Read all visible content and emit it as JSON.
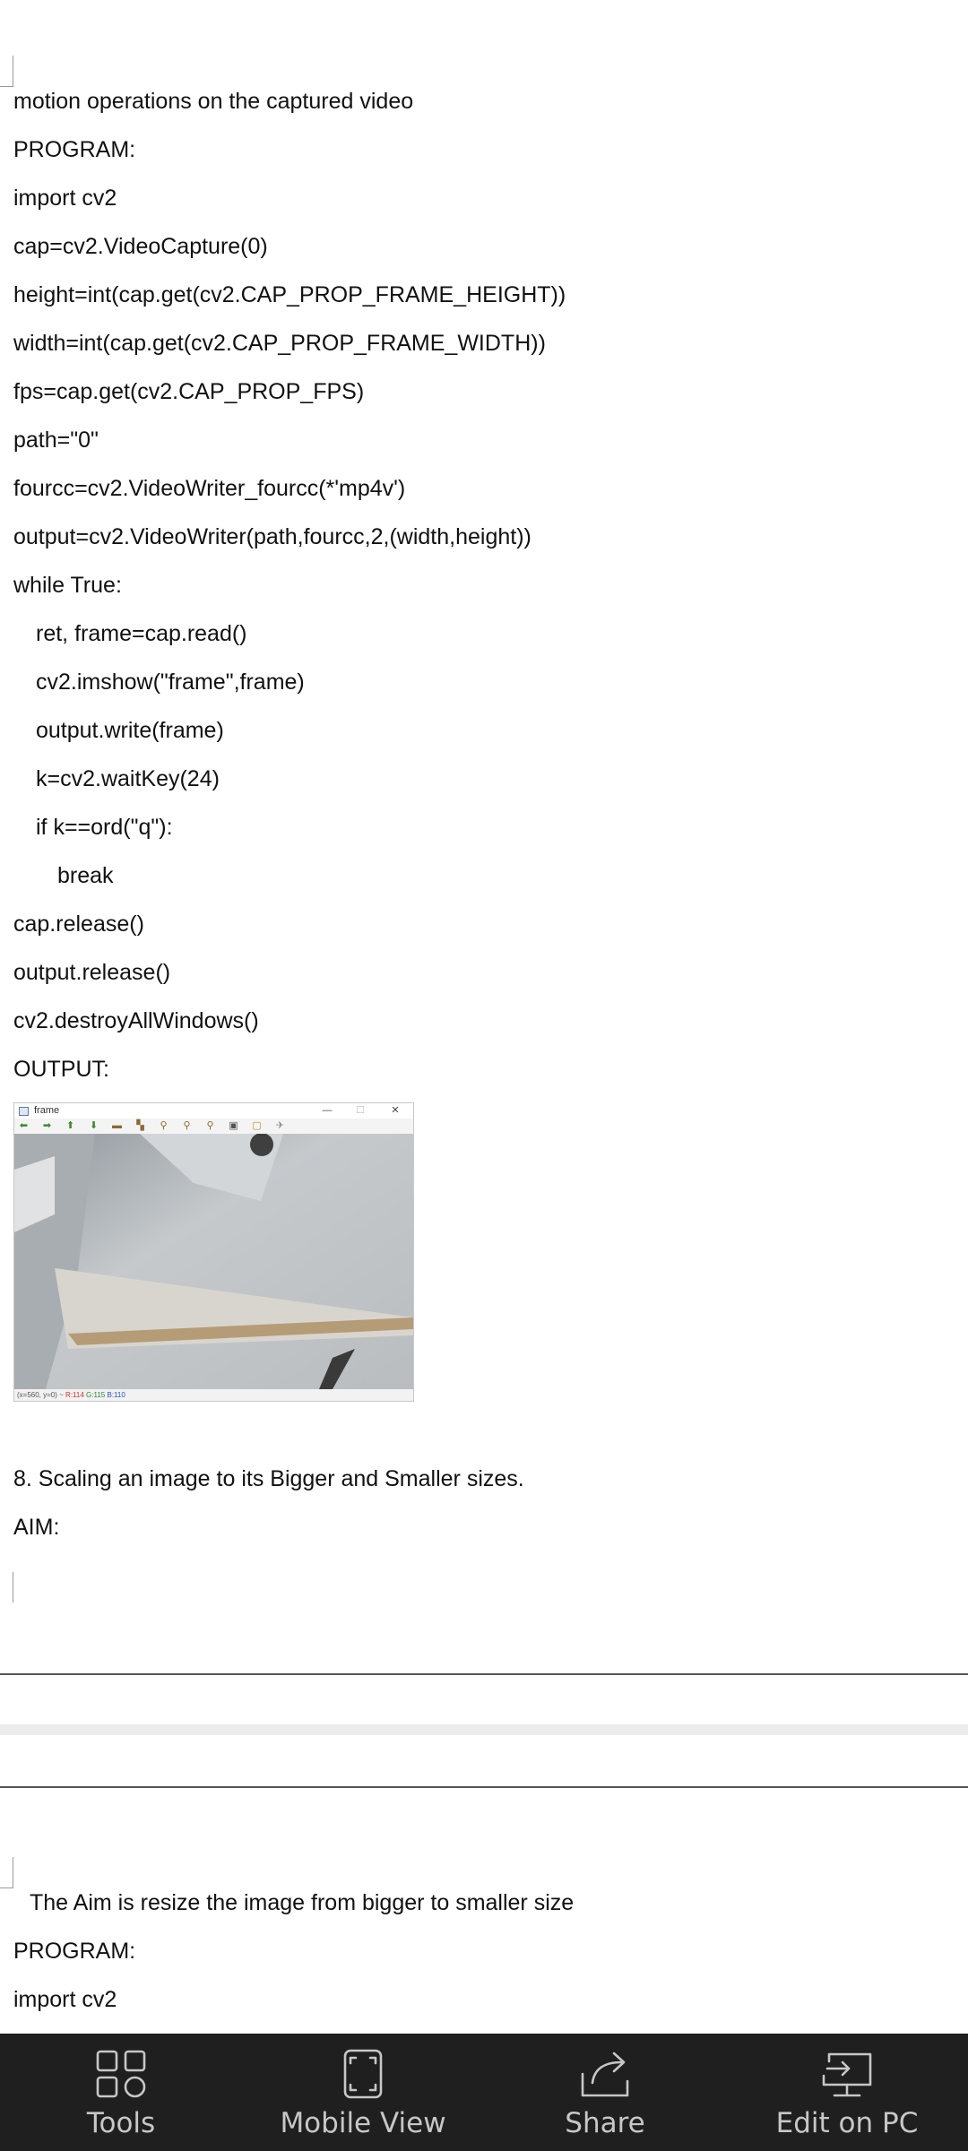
{
  "document": {
    "page1_lines": [
      "motion operations on the captured video",
      "PROGRAM:",
      "import cv2",
      "cap=cv2.VideoCapture(0)",
      "height=int(cap.get(cv2.CAP_PROP_FRAME_HEIGHT))",
      "width=int(cap.get(cv2.CAP_PROP_FRAME_WIDTH))",
      "fps=cap.get(cv2.CAP_PROP_FPS)",
      "path=\"0\"",
      "fourcc=cv2.VideoWriter_fourcc(*'mp4v')",
      "output=cv2.VideoWriter(path,fourcc,2,(width,height))",
      "while True:",
      "ret, frame=cap.read()",
      "cv2.imshow(\"frame\",frame)",
      "output.write(frame)",
      "k=cv2.waitKey(24)",
      "if k==ord(\"q\"):",
      "break",
      "cap.release()",
      "output.release()",
      "cv2.destroyAllWindows()",
      "OUTPUT:"
    ],
    "section_heading": "8. Scaling an image to its Bigger and Smaller sizes.",
    "aim_label": "AIM:",
    "page2_lines": [
      "The Aim is resize the image from bigger to smaller size",
      "PROGRAM:",
      "import cv2"
    ]
  },
  "output_window": {
    "title": "frame",
    "minimize": "—",
    "maximize": "☐",
    "close": "✕",
    "status_coords": "(x=560, y=0) ~",
    "status_r": "R:114",
    "status_g": "G:115",
    "status_b": "B:110"
  },
  "bottom_bar": {
    "tools_label": "Tools",
    "mobile_view_label": "Mobile View",
    "share_label": "Share",
    "edit_on_pc_label": "Edit on PC"
  },
  "icons": {
    "tools": "tools-grid-icon",
    "mobile_view": "mobile-view-icon",
    "share": "share-icon",
    "edit_on_pc": "edit-on-pc-icon"
  },
  "colors": {
    "bottom_bar_bg": "#1f1f1f",
    "bottom_bar_text": "#c7c7c7",
    "page_bg": "#ffffff"
  }
}
